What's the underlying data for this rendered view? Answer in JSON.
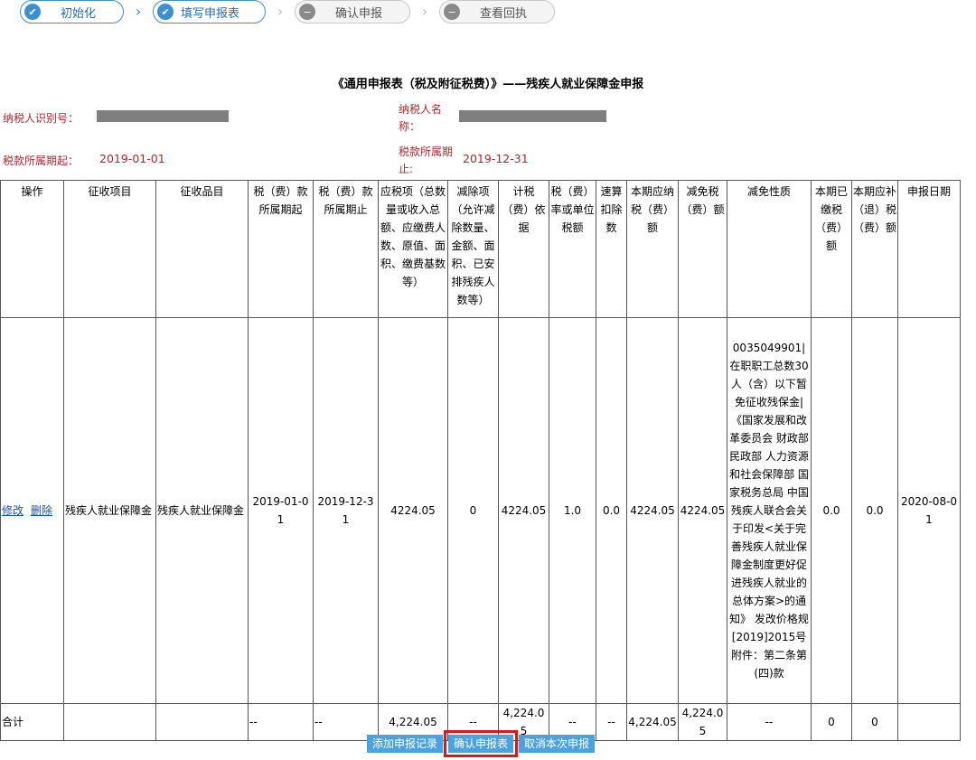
{
  "steps": [
    {
      "label": "初始化",
      "state": "done"
    },
    {
      "label": "填写申报表",
      "state": "done"
    },
    {
      "label": "确认申报",
      "state": "todo"
    },
    {
      "label": "查看回执",
      "state": "todo"
    }
  ],
  "title": "《通用申报表（税及附征税费）》——残疾人就业保障金申报",
  "info": {
    "taxpayer_id_label": "纳税人识别号：",
    "taxpayer_name_label_1": "纳税人名",
    "taxpayer_name_label_2": "称：",
    "period_start_label": "税款所属期起：",
    "period_start": "2019-01-01",
    "period_end_label_1": "税款所属期",
    "period_end_label_2": "止:",
    "period_end": "2019-12-31"
  },
  "headers": [
    "操作",
    "征收项目",
    "征收品目",
    "税（费）款所属期起",
    "税（费）款所属期止",
    "应税项（总数量或收入总额、应缴费人数、原值、面积、缴费基数等）",
    "减除项（允许减除数量、金额、面积、已安排残疾人数等）",
    "计税（费）依据",
    "税（费）率或单位税额",
    "速算扣除数",
    "本期应纳税（费）额",
    "减免税（费）额",
    "减免性质",
    "本期已缴税（费）额",
    "本期应补（退）税（费）额",
    "申报日期"
  ],
  "row": {
    "edit": "修改",
    "delete": "删除",
    "item": "残疾人就业保障金",
    "subitem": "残疾人就业保障金",
    "start": "2019-01-01",
    "end": "2019-12-31",
    "taxable": "4224.05",
    "deduction": "0",
    "basis": "4224.05",
    "rate": "1.0",
    "quick": "0.0",
    "payable": "4224.05",
    "relief": "4224.05",
    "nature": "0035049901|在职职工总数30人（含）以下暂免征收残保金|《国家发展和改革委员会 财政部 民政部 人力资源和社会保障部 国家税务总局 中国残疾人联合会关于印发<关于完善残疾人就业保障金制度更好促进残疾人就业的总体方案>的通知》 发改价格规[2019]2015号附件：第二条第(四)款",
    "paid": "0.0",
    "due": "0.0",
    "date": "2020-08-01"
  },
  "total": {
    "label": "合计",
    "start": "--",
    "end": "--",
    "taxable": "4,224.05",
    "deduction": "--",
    "basis": "4,224.05",
    "rate": "--",
    "quick": "--",
    "payable": "4,224.05",
    "relief": "4,224.05",
    "nature": "--",
    "paid": "0",
    "due": "0"
  },
  "buttons": {
    "add": "添加申报记录",
    "confirm": "确认申报表",
    "cancel": "取消本次申报"
  }
}
